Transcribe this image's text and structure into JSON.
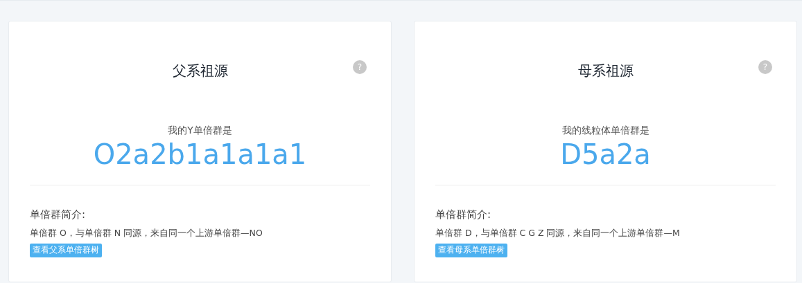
{
  "cards": [
    {
      "title": "父系祖源",
      "help": "?",
      "subtitle": "我的Y单倍群是",
      "haplogroup": "O2a2b1a1a1a1",
      "intro_label": "单倍群简介:",
      "intro_text": "单倍群 O，与单倍群 N 同源，来自同一个上游单倍群—NO",
      "tree_button": "查看父系单倍群树"
    },
    {
      "title": "母系祖源",
      "help": "?",
      "subtitle": "我的线粒体单倍群是",
      "haplogroup": "D5a2a",
      "intro_label": "单倍群简介:",
      "intro_text": "单倍群 D，与单倍群 C G Z 同源，来自同一个上游单倍群—M",
      "tree_button": "查看母系单倍群树"
    }
  ]
}
